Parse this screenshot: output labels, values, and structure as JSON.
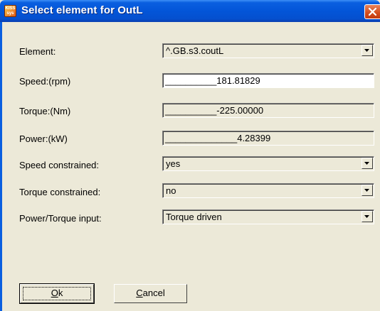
{
  "window": {
    "title": "Select element for OutL",
    "icon_text": "KISS\nsys"
  },
  "fields": {
    "element": {
      "label": "Element:",
      "value": "^.GB.s3.coutL"
    },
    "speed": {
      "label": "Speed:(rpm)",
      "value": "__________181.81829"
    },
    "torque": {
      "label": "Torque:(Nm)",
      "value": "__________-225.00000"
    },
    "power": {
      "label": "Power:(kW)",
      "value": "______________4.28399"
    },
    "speed_constrained": {
      "label": "Speed constrained:",
      "value": "yes"
    },
    "torque_constrained": {
      "label": "Torque constrained:",
      "value": "no"
    },
    "power_torque_input": {
      "label": "Power/Torque input:",
      "value": "Torque driven"
    }
  },
  "buttons": {
    "ok": {
      "mnemonic": "O",
      "rest": "k"
    },
    "cancel": {
      "mnemonic": "C",
      "rest": "ancel"
    }
  },
  "colors": {
    "titlebar": "#0355d8",
    "dialog_bg": "#ece9d8",
    "close": "#d24c1c"
  }
}
